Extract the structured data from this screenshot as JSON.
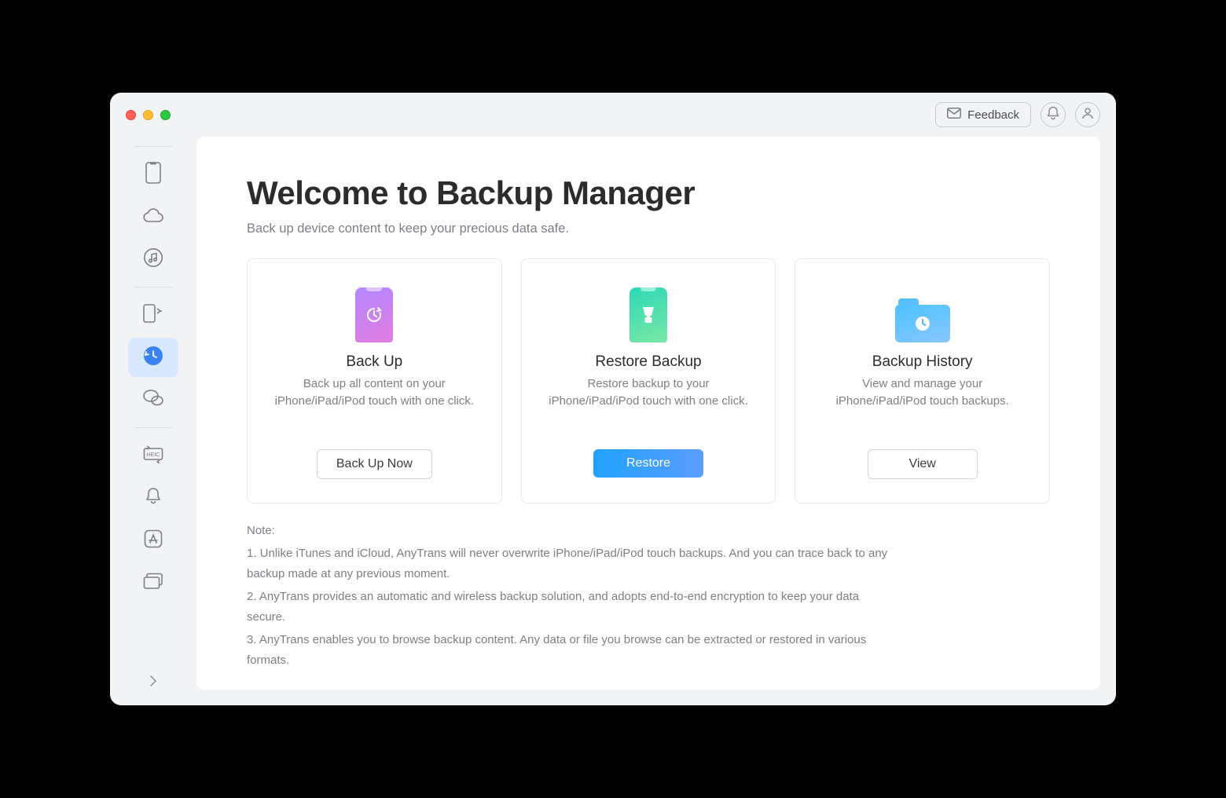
{
  "header": {
    "feedback_label": "Feedback"
  },
  "sidebar": {
    "items": [
      {
        "id": "device",
        "active": false
      },
      {
        "id": "icloud",
        "active": false
      },
      {
        "id": "music",
        "active": false
      },
      {
        "id": "transfer",
        "active": false
      },
      {
        "id": "backup-manager",
        "active": true
      },
      {
        "id": "messages",
        "active": false
      },
      {
        "id": "heic-convert",
        "active": false
      },
      {
        "id": "ringtones",
        "active": false
      },
      {
        "id": "app-downloader",
        "active": false
      },
      {
        "id": "screen-mirror",
        "active": false
      }
    ]
  },
  "main": {
    "title": "Welcome to Backup Manager",
    "subtitle": "Back up device content to keep your precious data safe.",
    "cards": [
      {
        "title": "Back Up",
        "desc": "Back up all content on your iPhone/iPad/iPod touch with one click.",
        "button_label": "Back Up Now",
        "primary": false
      },
      {
        "title": "Restore Backup",
        "desc": "Restore backup to your iPhone/iPad/iPod touch with one click.",
        "button_label": "Restore",
        "primary": true
      },
      {
        "title": "Backup History",
        "desc": "View and manage your iPhone/iPad/iPod touch backups.",
        "button_label": "View",
        "primary": false
      }
    ],
    "notes": {
      "heading": "Note:",
      "lines": [
        "1. Unlike iTunes and iCloud, AnyTrans will never overwrite iPhone/iPad/iPod touch backups. And you can trace back to any backup made at any previous moment.",
        "2. AnyTrans provides an automatic and wireless backup solution, and adopts end-to-end encryption to keep your data secure.",
        "3. AnyTrans enables you to browse backup content. Any data or file you browse can be extracted or restored in various formats."
      ]
    }
  }
}
